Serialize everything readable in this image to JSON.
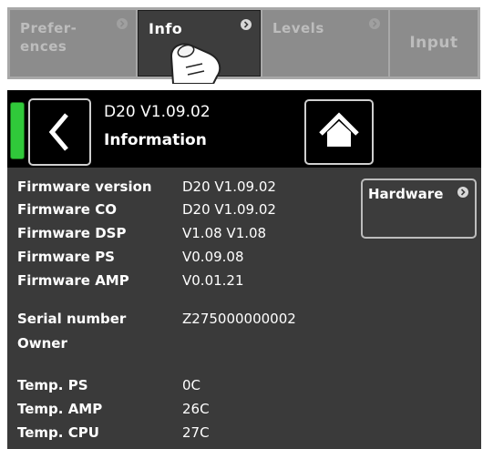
{
  "tabs": [
    {
      "label_line1": "Prefer-",
      "label_line2": "ences",
      "state": "inactive"
    },
    {
      "label": "Info",
      "state": "active"
    },
    {
      "label": "Levels",
      "state": "inactive"
    },
    {
      "label": "Input",
      "state": "inactive"
    }
  ],
  "header": {
    "version": "D20 V1.09.02",
    "title": "Information",
    "back_icon": "chevron-left-icon",
    "home_icon": "home-icon",
    "status_color": "#30c93a"
  },
  "hardware_button": {
    "label": "Hardware",
    "icon": "chevron-right-icon"
  },
  "info_rows": [
    {
      "label": "Firmware version",
      "value": "D20 V1.09.02"
    },
    {
      "label": "Firmware CO",
      "value": "D20 V1.09.02"
    },
    {
      "label": "Firmware DSP",
      "value": "V1.08 V1.08"
    },
    {
      "label": "Firmware PS",
      "value": "V0.09.08"
    },
    {
      "label": "Firmware AMP",
      "value": "V0.01.21"
    },
    {
      "label": "Serial number",
      "value": "Z275000000002"
    },
    {
      "label": "Owner",
      "value": ""
    },
    {
      "label": "Temp. PS",
      "value": "0C"
    },
    {
      "label": "Temp. AMP",
      "value": "26C"
    },
    {
      "label": "Temp. CPU",
      "value": "27C"
    }
  ]
}
